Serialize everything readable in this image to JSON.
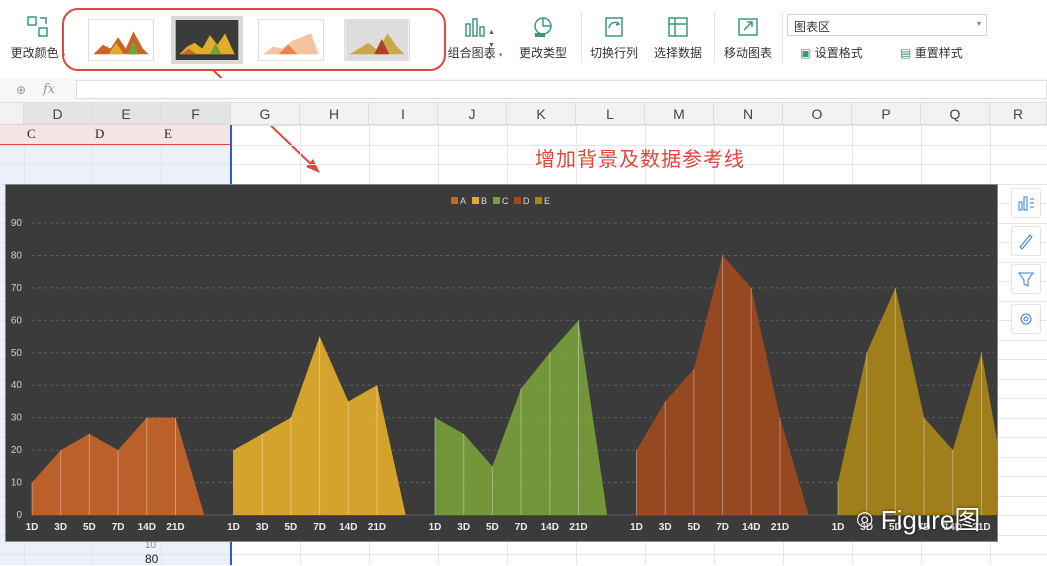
{
  "ribbon": {
    "change_color_label": "更改颜色",
    "combo_chart_label": "组合图表",
    "change_type_label": "更改类型",
    "switch_rowcol_label": "切换行列",
    "select_data_label": "选择数据",
    "move_chart_label": "移动图表",
    "element_select_value": "图表区",
    "set_format_label": "设置格式",
    "reset_style_label": "重置样式"
  },
  "formula_bar": {
    "fx": "fx"
  },
  "sheet": {
    "columns": [
      "D",
      "E",
      "F",
      "G",
      "H",
      "I",
      "J",
      "K",
      "L",
      "M",
      "N",
      "O",
      "P",
      "Q",
      "R"
    ],
    "row_cells": [
      "C",
      "D",
      "E"
    ],
    "below_value": "80",
    "below_partial": "10"
  },
  "annotation": "增加背景及数据参考线",
  "watermark": "Figure图",
  "chart_data": {
    "type": "area",
    "title": "",
    "legend_position": "top",
    "legend": [
      "A",
      "B",
      "C",
      "D",
      "E"
    ],
    "grid": true,
    "ylim": [
      0,
      90
    ],
    "yticks": [
      0,
      10,
      20,
      30,
      40,
      50,
      60,
      70,
      80,
      90
    ],
    "categories": [
      "1D",
      "3D",
      "5D",
      "7D",
      "14D",
      "21D"
    ],
    "series": [
      {
        "name": "A",
        "color": "#c8642a",
        "values": [
          10,
          20,
          25,
          20,
          30,
          30
        ]
      },
      {
        "name": "B",
        "color": "#e2ad2a",
        "values": [
          20,
          25,
          30,
          55,
          35,
          40
        ]
      },
      {
        "name": "C",
        "color": "#7a9e3c",
        "values": [
          30,
          25,
          15,
          39,
          50,
          60
        ]
      },
      {
        "name": "D",
        "color": "#9e4a1e",
        "values": [
          20,
          35,
          45,
          80,
          70,
          30
        ]
      },
      {
        "name": "E",
        "color": "#a8861a",
        "values": [
          10,
          50,
          70,
          30,
          20,
          50
        ]
      }
    ]
  }
}
